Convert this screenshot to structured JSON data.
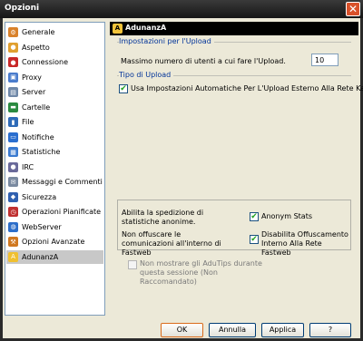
{
  "window": {
    "title": "Opzioni",
    "close_glyph": "✕"
  },
  "sidebar": {
    "items": [
      {
        "label": "Generale",
        "icon": "gear-icon",
        "color": "#d9822b",
        "glyph": "⚙"
      },
      {
        "label": "Aspetto",
        "icon": "palette-icon",
        "color": "#e0a030",
        "glyph": "●"
      },
      {
        "label": "Connessione",
        "icon": "connection-icon",
        "color": "#c82828",
        "glyph": "●"
      },
      {
        "label": "Proxy",
        "icon": "proxy-icon",
        "color": "#4a7ccc",
        "glyph": "▣"
      },
      {
        "label": "Server",
        "icon": "server-icon",
        "color": "#6f88a8",
        "glyph": "▤"
      },
      {
        "label": "Cartelle",
        "icon": "folder-icon",
        "color": "#2a8a40",
        "glyph": "▬"
      },
      {
        "label": "File",
        "icon": "file-icon",
        "color": "#2e6bb8",
        "glyph": "▮"
      },
      {
        "label": "Notifiche",
        "icon": "notification-icon",
        "color": "#2a6ecf",
        "glyph": "▭"
      },
      {
        "label": "Statistiche",
        "icon": "statistics-icon",
        "color": "#3a7ad0",
        "glyph": "▦"
      },
      {
        "label": "IRC",
        "icon": "irc-icon",
        "color": "#6a6a9a",
        "glyph": "●"
      },
      {
        "label": "Messaggi e Commenti",
        "icon": "messages-icon",
        "color": "#7a8aa0",
        "glyph": "✉"
      },
      {
        "label": "Sicurezza",
        "icon": "security-icon",
        "color": "#3060b0",
        "glyph": "◆"
      },
      {
        "label": "Operazioni Pianificate",
        "icon": "scheduled-icon",
        "color": "#c03030",
        "glyph": "◷"
      },
      {
        "label": "WebServer",
        "icon": "webserver-icon",
        "color": "#2d6ec9",
        "glyph": "◍"
      },
      {
        "label": "Opzioni Avanzate",
        "icon": "advanced-options-icon",
        "color": "#d07820",
        "glyph": "⚒"
      },
      {
        "label": "AdunanzA",
        "icon": "adunanza-icon",
        "color": "#f0c030",
        "glyph": "A"
      }
    ]
  },
  "header": {
    "title": "AdunanzA",
    "icon_glyph": "A"
  },
  "upload": {
    "group_title": "Impostazioni per l'Upload",
    "max_users_label": "Massimo numero di utenti a cui fare l'Upload.",
    "max_users_value": "10",
    "type_group_title": "Tipo di Upload",
    "auto_label": "Usa Impostazioni Automatiche Per L'Upload Esterno Alla Rete Kadu",
    "auto_checked": "✔"
  },
  "stats": {
    "enable_label": "Abilita la spedizione di statistiche anonime.",
    "anonym_label": "Anonym Stats",
    "anonym_checked": "✔",
    "obfuscate_label": "Non offuscare le comunicazioni all'interno di Fastweb",
    "disable_obf_label": "Disabilita Offuscamento Interno Alla Rete Fastweb",
    "disable_obf_checked": "✔"
  },
  "adutips": {
    "label": "Non mostrare gli AduTips durante questa sessione (Non Raccomandato)",
    "checked": ""
  },
  "buttons": {
    "ok": "OK",
    "cancel": "Annulla",
    "apply": "Applica",
    "help": "?"
  }
}
